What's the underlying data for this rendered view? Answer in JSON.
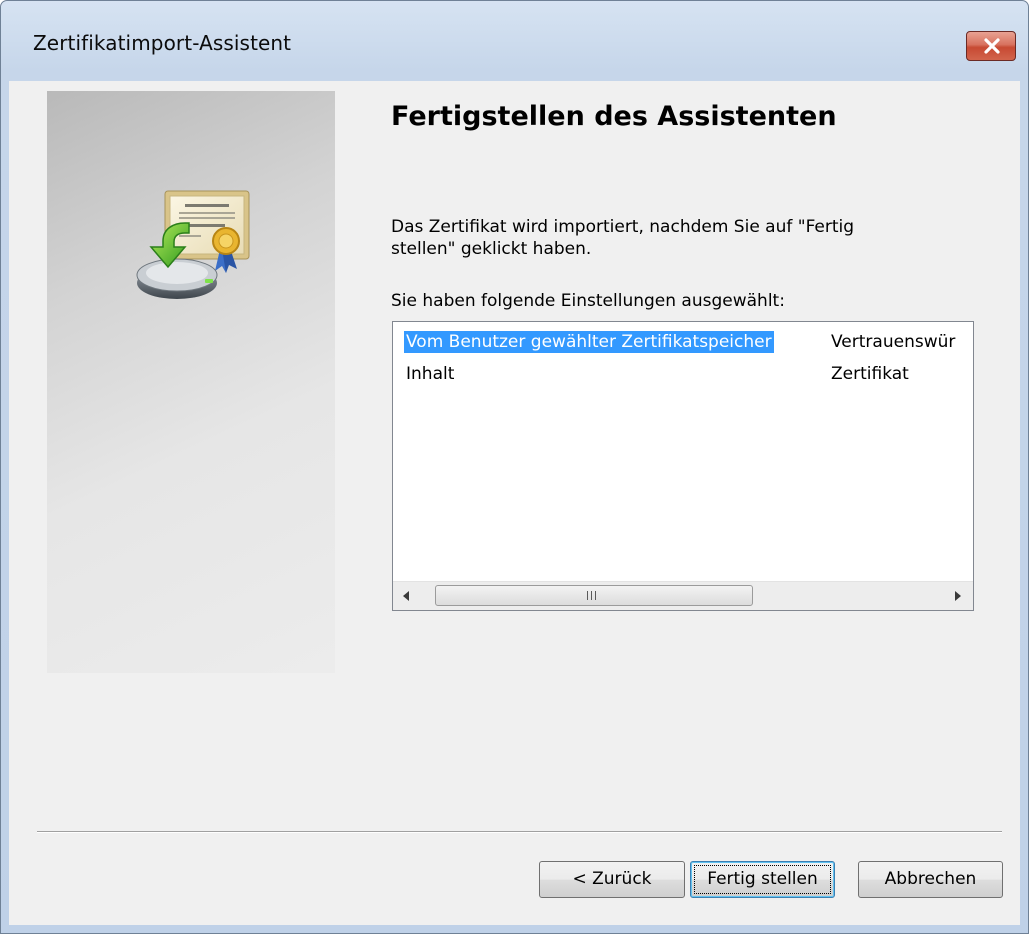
{
  "window": {
    "title": "Zertifikatimport-Assistent",
    "close_icon": "close-icon"
  },
  "wizard": {
    "image_icon": "certificate-import-icon",
    "heading": "Fertigstellen des Assistenten",
    "intro": "Das Zertifikat wird importiert, nachdem Sie auf \"Fertig stellen\" geklickt haben.",
    "settings_label": "Sie haben folgende Einstellungen ausgewählt:"
  },
  "settings": {
    "rows": [
      {
        "setting": "Vom Benutzer gewählter Zertifikatspeicher",
        "value": "Vertrauenswür",
        "selected": true
      },
      {
        "setting": "Inhalt",
        "value": "Zertifikat",
        "selected": false
      }
    ]
  },
  "buttons": {
    "back": "< Zurück",
    "finish": "Fertig stellen",
    "cancel": "Abbrechen"
  },
  "colors": {
    "selection": "#3399ff",
    "close_button": "#c74a33",
    "title_bar": "#c6d6ea"
  }
}
